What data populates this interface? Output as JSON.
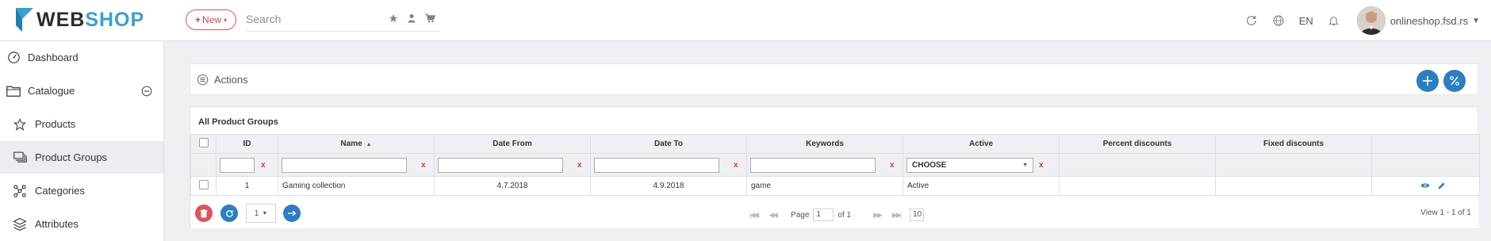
{
  "header": {
    "logo": {
      "part1": "WEB",
      "part2": "SHOP"
    },
    "new_label": "New",
    "search_placeholder": "Search",
    "language": "EN",
    "site": "onlineshop.fsd.rs"
  },
  "sidebar": {
    "items": [
      {
        "label": "Dashboard",
        "icon": "dashboard-icon"
      },
      {
        "label": "Catalogue",
        "icon": "folder-icon"
      },
      {
        "label": "Products",
        "icon": "star-icon"
      },
      {
        "label": "Product Groups",
        "icon": "stack-icon"
      },
      {
        "label": "Categories",
        "icon": "categories-icon"
      },
      {
        "label": "Attributes",
        "icon": "layers-icon"
      }
    ]
  },
  "actions": {
    "title": "Actions"
  },
  "grid": {
    "title": "All Product Groups",
    "columns": [
      "ID",
      "Name",
      "Date From",
      "Date To",
      "Keywords",
      "Active",
      "Percent discounts",
      "Fixed discounts"
    ],
    "filter_clear": "x",
    "active_filter": "CHOOSE",
    "rows": [
      {
        "id": "1",
        "name": "Gaming collection",
        "date_from": "4.7.2018",
        "date_to": "4.9.2018",
        "keywords": "game",
        "active": "Active",
        "percent": "",
        "fixed": ""
      }
    ]
  },
  "pager": {
    "page_size": "1",
    "page_label": "Page",
    "page_value": "1",
    "of_label": "of 1",
    "rows_per_page": "10",
    "view_text": "View 1 - 1 of 1"
  },
  "colors": {
    "accent": "#2a7ec1",
    "danger": "#e0404b",
    "logo_blue": "#36a1d4"
  }
}
